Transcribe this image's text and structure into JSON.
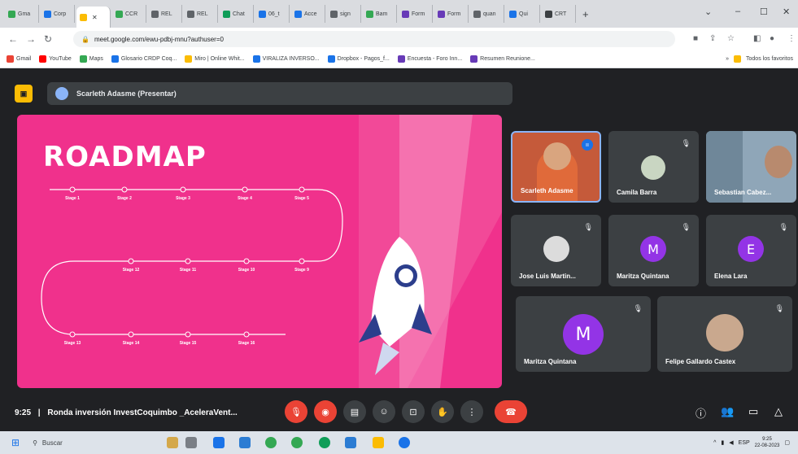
{
  "browser": {
    "tabs": [
      {
        "label": "Gma",
        "color": "#34a853"
      },
      {
        "label": "Corp",
        "color": "#1a73e8"
      },
      {
        "label": "",
        "color": "#fbbc04",
        "active": true
      },
      {
        "label": "CCR",
        "color": "#34a853"
      },
      {
        "label": "REL",
        "color": "#5f6368"
      },
      {
        "label": "REL",
        "color": "#5f6368"
      },
      {
        "label": "Chat",
        "color": "#0f9d58"
      },
      {
        "label": "06_t",
        "color": "#1a73e8"
      },
      {
        "label": "Acce",
        "color": "#1a73e8"
      },
      {
        "label": "sign",
        "color": "#5f6368"
      },
      {
        "label": "Bam",
        "color": "#34a853"
      },
      {
        "label": "Form",
        "color": "#673ab7"
      },
      {
        "label": "Form",
        "color": "#673ab7"
      },
      {
        "label": "quan",
        "color": "#5f6368"
      },
      {
        "label": "Qui",
        "color": "#1a73e8"
      },
      {
        "label": "CRT",
        "color": "#3c4043"
      }
    ],
    "new_tab": "+",
    "url": "meet.google.com/ewu-pdbj-mnu?authuser=0",
    "bookmarks": [
      {
        "label": "Gmail",
        "color": "#ea4335"
      },
      {
        "label": "YouTube",
        "color": "#ff0000"
      },
      {
        "label": "Maps",
        "color": "#34a853"
      },
      {
        "label": "Glosario CRDP Coq...",
        "color": "#1a73e8"
      },
      {
        "label": "Miro | Online Whit...",
        "color": "#fbbc04"
      },
      {
        "label": "VIRALIZA INVERSO...",
        "color": "#1a73e8"
      },
      {
        "label": "Dropbox - Pagos_f...",
        "color": "#1a73e8"
      },
      {
        "label": "Encuesta - Foro Inn...",
        "color": "#673ab7"
      },
      {
        "label": "Resumen Reunione...",
        "color": "#673ab7"
      }
    ],
    "bookmarks_more": "»",
    "all_bookmarks": "Todos los favoritos"
  },
  "meet": {
    "presenter_label": "Scarleth Adasme (Presentar)",
    "slide": {
      "title": "ROADMAP",
      "top_stages": [
        "Stage 1",
        "Stage 2",
        "Stage 3",
        "Stage 4",
        "Stage 5"
      ],
      "mid_stages": [
        "Stage 12",
        "Stage 11",
        "Stage 10",
        "Stage 9"
      ],
      "bottom_stages": [
        "Stage 13",
        "Stage 14",
        "Stage 15",
        "Stage 16"
      ]
    },
    "participants": [
      {
        "name": "Scarleth Adasme",
        "type": "video",
        "speaking": true
      },
      {
        "name": "Camila Barra",
        "type": "photo"
      },
      {
        "name": "Sebastian Cabez...",
        "type": "video"
      },
      {
        "name": "Jose Luis Martin...",
        "type": "photo"
      },
      {
        "name": "Maritza Quintana",
        "type": "letter",
        "letter": "M",
        "color": "#9334e6"
      },
      {
        "name": "Elena Lara",
        "type": "letter",
        "letter": "E",
        "color": "#9334e6"
      },
      {
        "name": "Maritza Quintana",
        "type": "letter",
        "letter": "M",
        "color": "#9334e6"
      },
      {
        "name": "Felipe Gallardo Castex",
        "type": "photo"
      }
    ],
    "time": "9:25",
    "separator": "|",
    "meeting_title": "Ronda inversión InvestCoquimbo _AceleraVent..."
  },
  "taskbar": {
    "search_placeholder": "Buscar",
    "lang": "ESP",
    "clock_time": "9:25",
    "clock_date": "22-08-2023"
  }
}
